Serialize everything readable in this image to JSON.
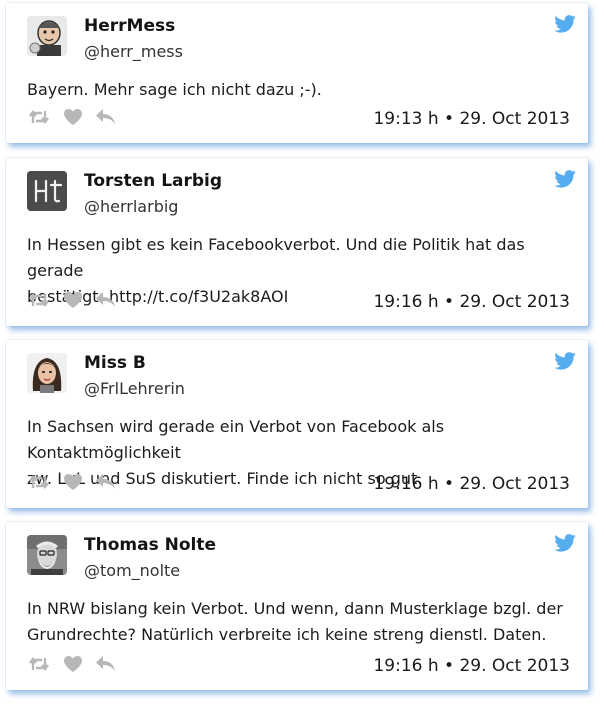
{
  "brand": {
    "accent": "#55acee",
    "icon_gray": "#b7b7b7"
  },
  "icons": {
    "bird": "twitter-bird-icon",
    "retweet": "retweet-icon",
    "like": "heart-icon",
    "reply": "reply-icon"
  },
  "tweets": [
    {
      "name": "HerrMess",
      "handle": "@herr_mess",
      "lines": [
        "Bayern. Mehr sage ich nicht dazu ;-)."
      ],
      "timestamp": "19:13 h • 29. Oct 2013",
      "avatar_text": ""
    },
    {
      "name": "Torsten Larbig",
      "handle": "@herrlarbig",
      "lines": [
        "In Hessen gibt es kein Facebookverbot. Und die Politik hat das gerade",
        "bestätigt: http://t.co/f3U2ak8AOI"
      ],
      "timestamp": "19:16 h • 29. Oct 2013",
      "avatar_text": "Ht"
    },
    {
      "name": "Miss B",
      "handle": "@FrlLehrerin",
      "lines": [
        "In Sachsen wird gerade ein Verbot von Facebook als Kontaktmöglichkeit",
        "zw. LuL und SuS diskutiert. Finde ich nicht so gut."
      ],
      "timestamp": "19:16 h • 29. Oct 2013",
      "avatar_text": ""
    },
    {
      "name": "Thomas Nolte",
      "handle": "@tom_nolte",
      "lines": [
        "In NRW bislang kein Verbot. Und wenn, dann Musterklage bzgl. der",
        "Grundrechte? Natürlich verbreite ich keine streng dienstl. Daten."
      ],
      "timestamp": "19:16 h • 29. Oct 2013",
      "avatar_text": ""
    }
  ]
}
